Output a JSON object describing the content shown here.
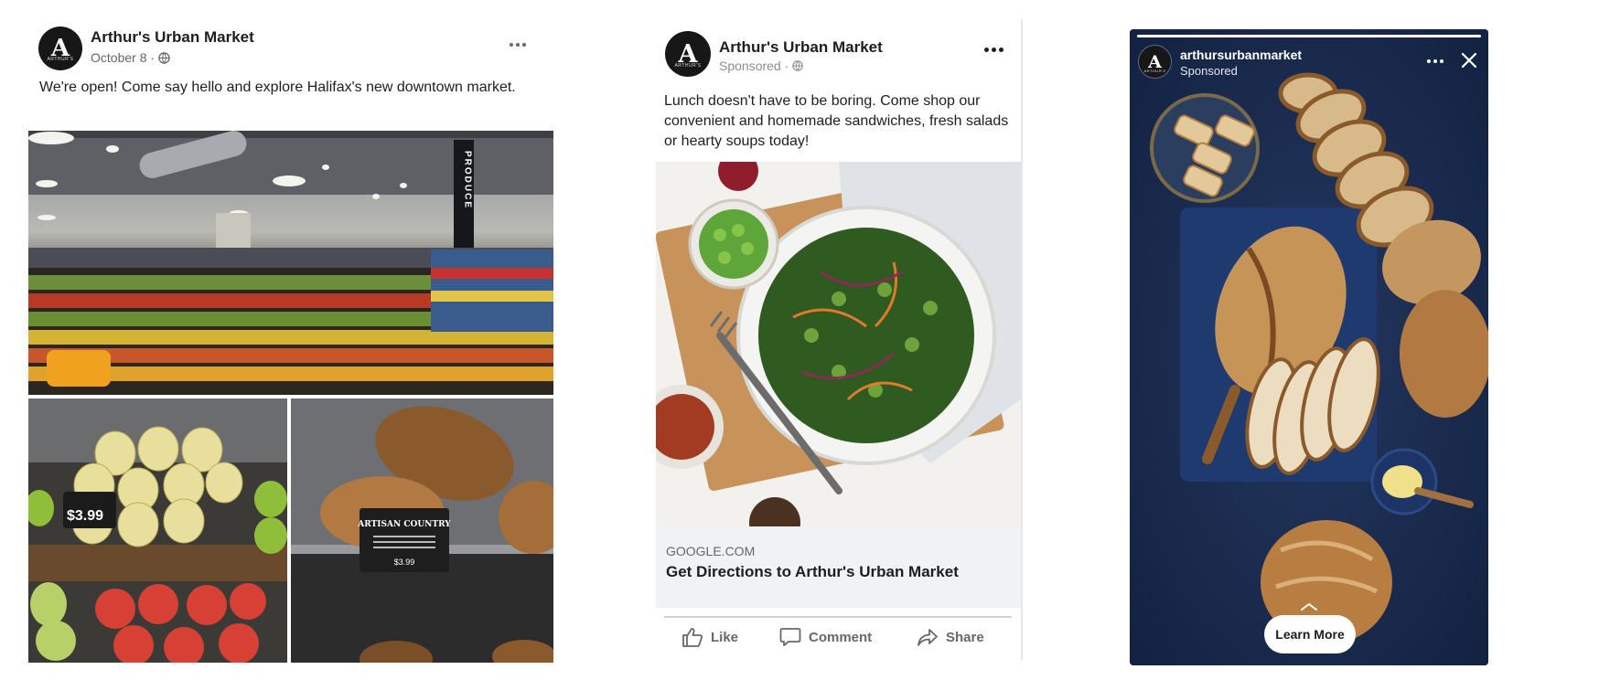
{
  "post1": {
    "page_name": "Arthur's Urban Market",
    "date": "October 8 ·",
    "caption": "We're open! Come say hello and explore Halifax's new downtown market.",
    "produce_sign": "PRODUCE",
    "pear_tag": "$3.99",
    "bread_sign_title": "ARTISAN COUNTRY",
    "bread_sign_price": "$3.99"
  },
  "post2": {
    "page_name": "Arthur's Urban Market",
    "sponsored": "Sponsored ·",
    "caption": "Lunch doesn't have to be boring. Come shop our convenient and homemade sandwiches, fresh salads or hearty soups today!",
    "link_domain": "GOOGLE.COM",
    "link_title": "Get Directions to Arthur's Urban Market",
    "actions": {
      "like": "Like",
      "comment": "Comment",
      "share": "Share"
    }
  },
  "story": {
    "username": "arthursurbanmarket",
    "sponsored": "Sponsored",
    "progress": 1.0,
    "cta": "Learn More"
  },
  "avatar": {
    "letter": "A",
    "subtext": "ARTHUR'S"
  },
  "colors": {
    "text_primary": "#1c1e21",
    "text_secondary": "#65676b",
    "link_bg": "#f0f2f5",
    "story_bg": "#1a2b4f",
    "divider": "#ced0d4"
  }
}
